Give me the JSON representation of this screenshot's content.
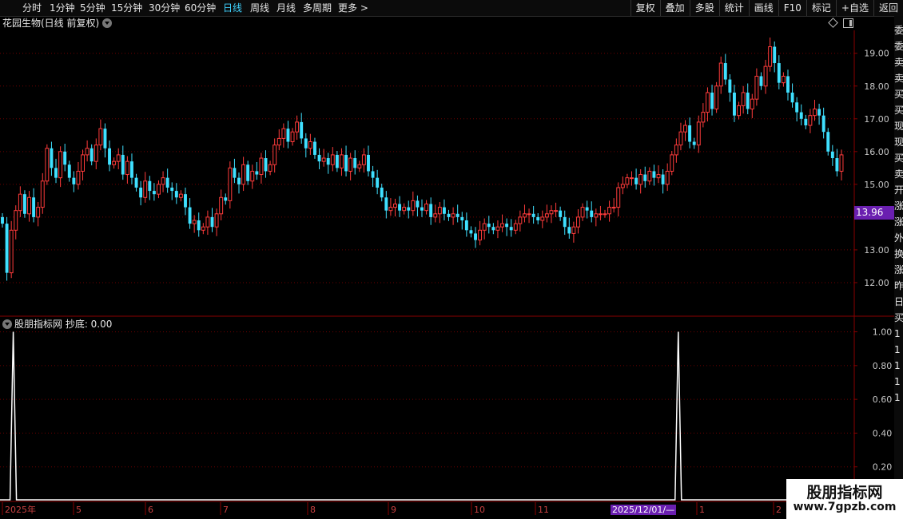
{
  "toolbar": {
    "left_items": [
      "分时",
      "1分钟",
      "5分钟",
      "15分钟",
      "30分钟",
      "60分钟",
      "日线",
      "周线",
      "月线",
      "多周期",
      "更多 >"
    ],
    "active": "日线",
    "right_items": [
      "复权",
      "叠加",
      "多股",
      "统计",
      "画线",
      "F10",
      "标记",
      "+自选",
      "返回"
    ]
  },
  "chart": {
    "title": "花园生物(日线 前复权)",
    "last_price_label": "13.96",
    "y_ticks": [
      "19.00",
      "18.00",
      "17.00",
      "16.00",
      "15.00",
      "13.00",
      "12.00"
    ]
  },
  "indicator": {
    "title": "股朋指标网 抄底: 0.00",
    "y_ticks": [
      "1.00",
      "0.80",
      "0.60",
      "0.40",
      "0.20"
    ]
  },
  "xaxis": {
    "labels": [
      "2025年",
      "5",
      "6",
      "7",
      "8",
      "9",
      "10",
      "11",
      "1",
      "2"
    ],
    "date_tag": "2025/12/01/—"
  },
  "side_strip": [
    "委",
    "委",
    "卖",
    "卖",
    "买",
    "买",
    "现",
    "现",
    "买",
    "卖",
    "开",
    "涨",
    "涨",
    "外",
    "换",
    "涨",
    "昨",
    "日",
    "买",
    "1",
    "1",
    "1",
    "1",
    "1"
  ],
  "watermark": {
    "title": "股朋指标网",
    "url": "www.7gpzb.com"
  },
  "colors": {
    "up": "#ff3b3b",
    "down": "#3fe0ff",
    "grid": "#6e0000",
    "axis": "#8a0000",
    "active_tab": "#3fd3ff",
    "tag": "#6a1fb0"
  },
  "chart_data": [
    {
      "type": "candlestick",
      "title": "花园生物(日线 前复权)",
      "ylim": [
        11.0,
        19.7
      ],
      "y_ticks": [
        12,
        13,
        14,
        15,
        16,
        17,
        18,
        19
      ],
      "grid": true,
      "last_value": 13.96,
      "closes": [
        13.8,
        12.3,
        13.6,
        14.2,
        14.7,
        14.1,
        14.6,
        14.0,
        14.3,
        15.1,
        16.1,
        15.5,
        15.2,
        16.0,
        15.6,
        15.2,
        15.0,
        15.4,
        15.9,
        16.1,
        15.7,
        16.2,
        16.7,
        16.1,
        15.6,
        15.7,
        15.9,
        15.3,
        15.7,
        15.2,
        14.9,
        14.6,
        15.1,
        14.8,
        14.7,
        15.0,
        15.2,
        14.9,
        14.8,
        14.6,
        14.7,
        14.3,
        13.8,
        13.9,
        13.6,
        13.7,
        14.0,
        13.7,
        14.1,
        14.6,
        14.5,
        15.5,
        15.2,
        15.0,
        15.6,
        15.1,
        15.4,
        15.3,
        15.8,
        15.4,
        15.6,
        16.2,
        16.4,
        16.7,
        16.3,
        16.6,
        16.9,
        16.4,
        16.1,
        16.3,
        15.9,
        15.7,
        15.8,
        15.6,
        15.9,
        15.5,
        15.9,
        15.4,
        15.8,
        15.5,
        15.6,
        15.9,
        15.4,
        15.2,
        14.9,
        14.6,
        14.2,
        14.3,
        14.4,
        14.2,
        14.3,
        14.2,
        14.5,
        14.3,
        14.2,
        14.4,
        14.0,
        14.1,
        14.3,
        14.1,
        14.0,
        14.1,
        14.0,
        13.9,
        13.6,
        13.5,
        13.3,
        13.6,
        13.8,
        13.7,
        13.6,
        13.7,
        13.8,
        13.7,
        13.6,
        13.8,
        14.0,
        14.1,
        14.1,
        14.0,
        13.9,
        14.0,
        14.1,
        14.2,
        14.2,
        14.0,
        13.7,
        13.5,
        13.7,
        14.0,
        14.3,
        14.2,
        14.0,
        14.1,
        14.1,
        14.1,
        14.3,
        14.3,
        14.9,
        15.0,
        15.2,
        15.2,
        15.0,
        15.3,
        15.1,
        15.4,
        15.2,
        15.3,
        15.0,
        15.4,
        15.9,
        16.2,
        16.6,
        16.8,
        16.3,
        16.2,
        16.9,
        17.2,
        17.8,
        17.3,
        18.0,
        18.7,
        18.2,
        17.8,
        17.1,
        17.4,
        17.8,
        17.3,
        17.6,
        18.3,
        18.0,
        18.6,
        19.2,
        18.7,
        18.1,
        18.3,
        17.8,
        17.5,
        17.2,
        17.0,
        16.8,
        17.1,
        17.3,
        17.1,
        16.6,
        16.0,
        15.8,
        15.4,
        15.9
      ],
      "volume_signal": {
        "ylim": [
          0,
          1.05
        ],
        "spikes": [
          {
            "index": 1,
            "value": 1.0
          },
          {
            "index": 150,
            "value": 1.0
          }
        ]
      }
    }
  ]
}
